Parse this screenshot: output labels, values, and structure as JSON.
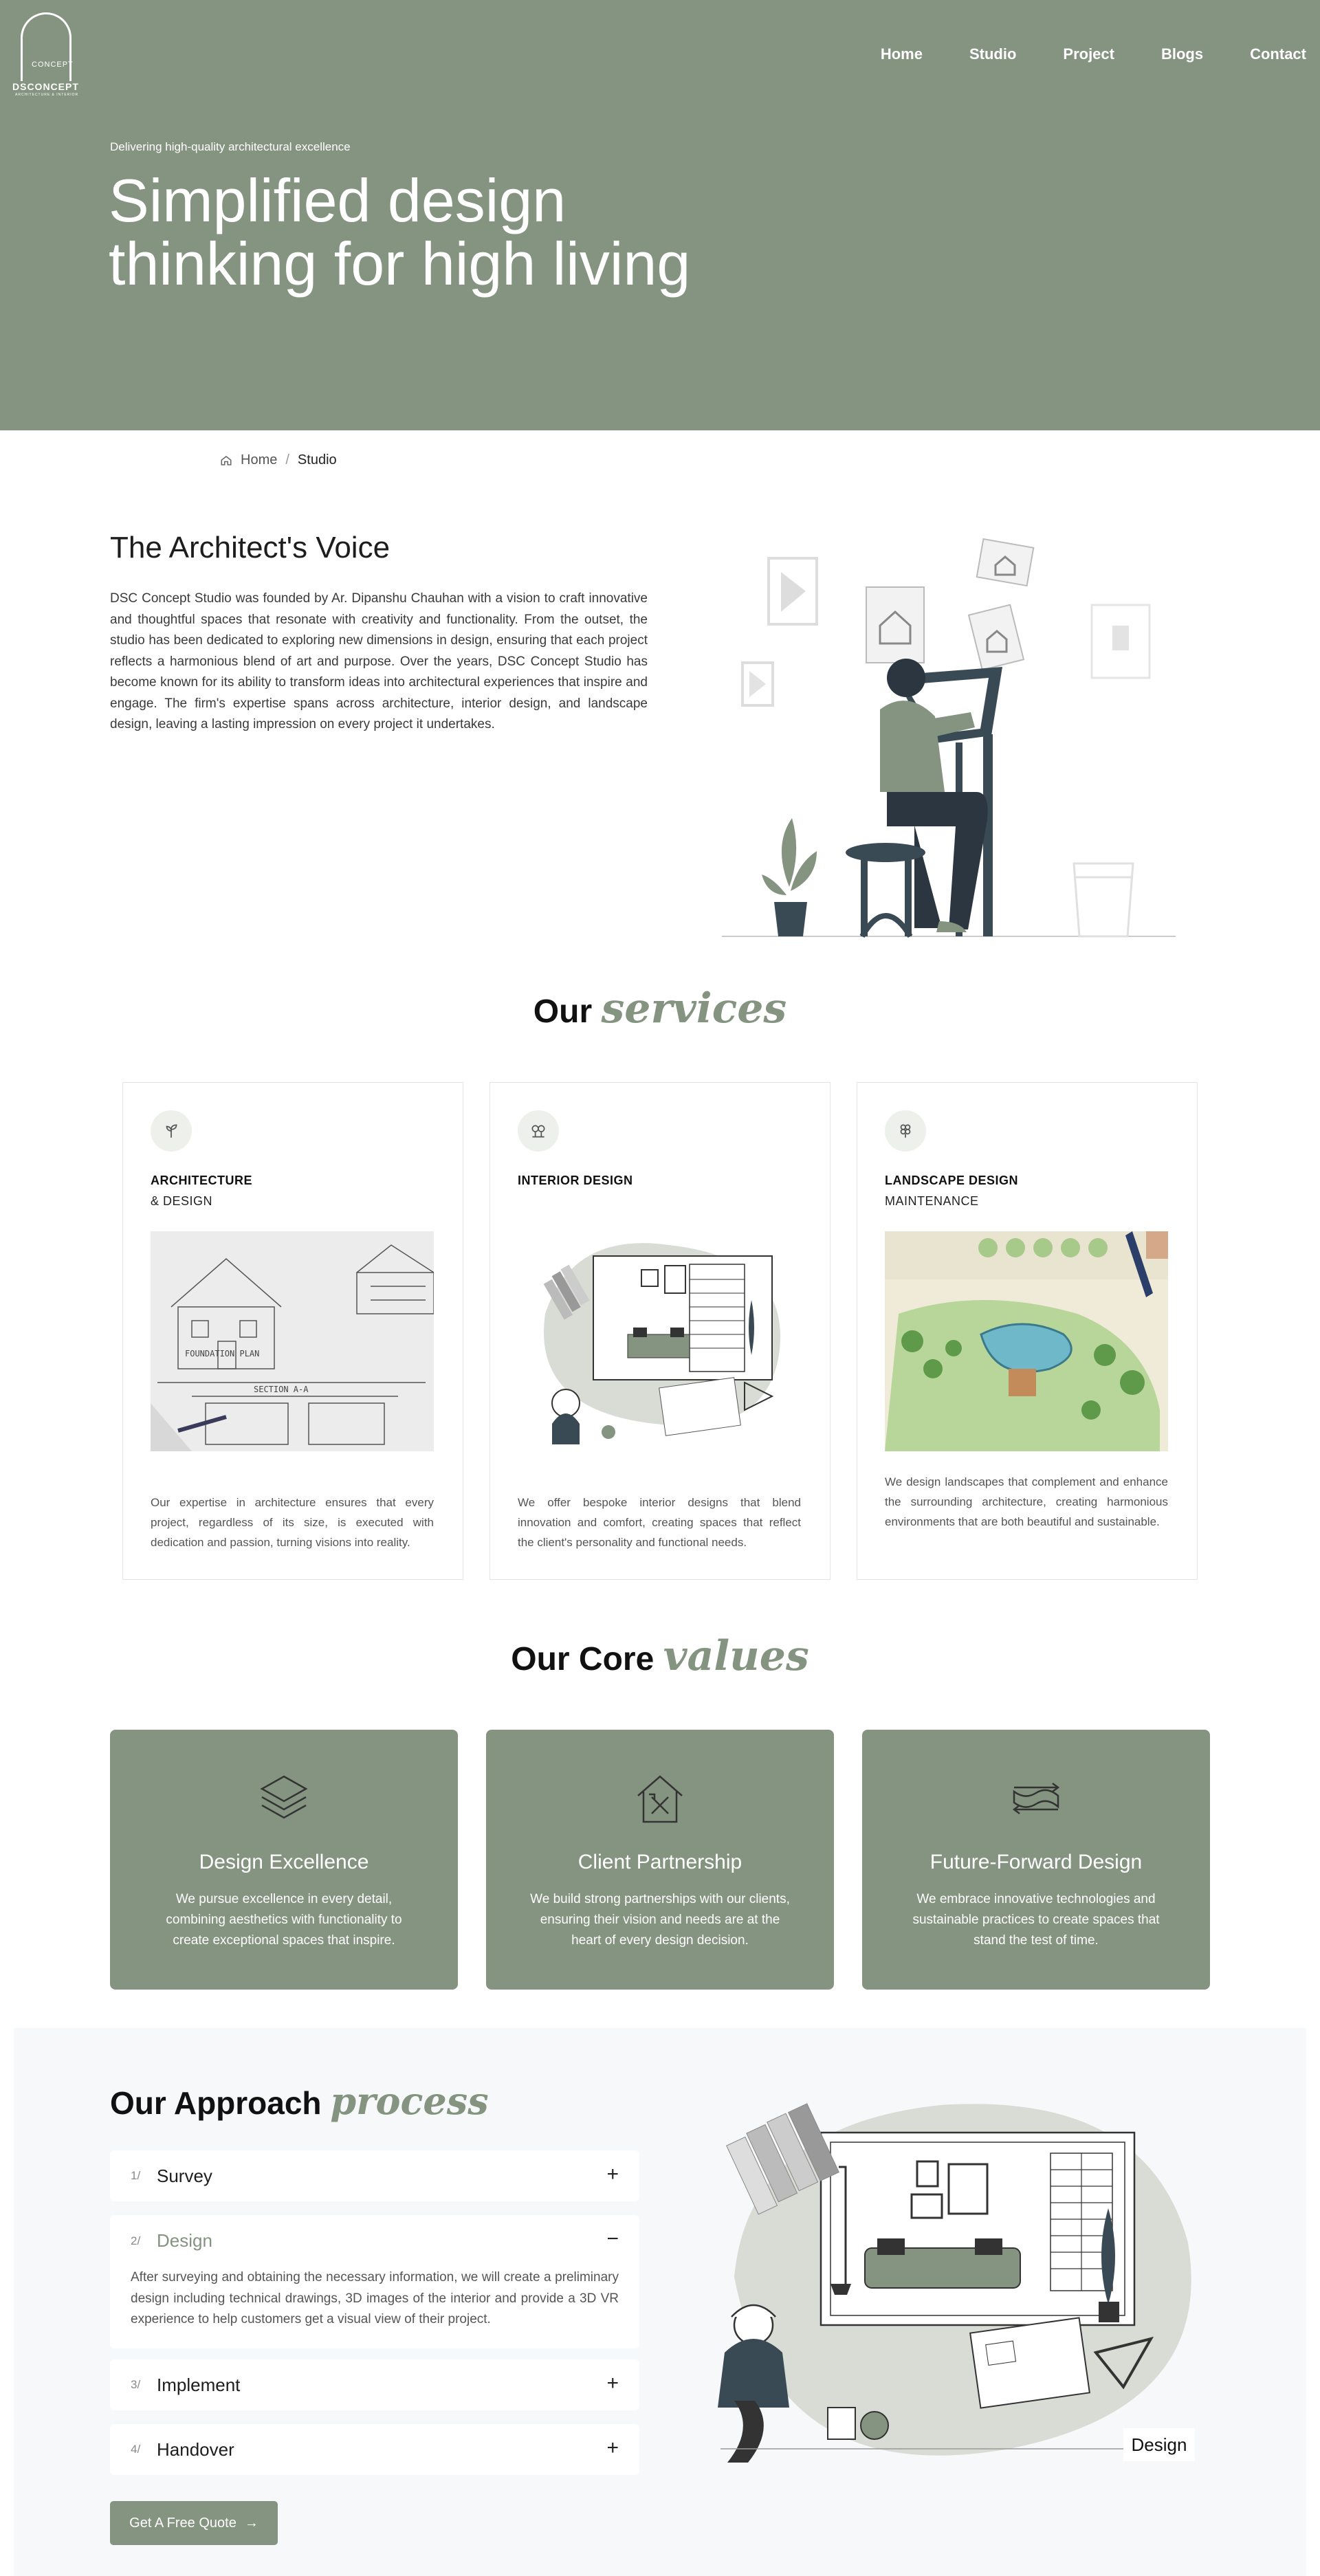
{
  "brand": {
    "name": "DSCONCEPT",
    "concept_word": "CONCEPT",
    "tagline": "ARCHITECTURE & INTERIOR"
  },
  "nav": {
    "items": [
      "Home",
      "Studio",
      "Project",
      "Blogs",
      "Contact"
    ]
  },
  "hero": {
    "kicker": "Delivering high-quality architectural excellence",
    "title_line1": "Simplified design",
    "title_line2": "thinking for high living"
  },
  "breadcrumb": {
    "home": "Home",
    "separator": "/",
    "current": "Studio"
  },
  "about": {
    "title": "The Architect's Voice",
    "text": "DSC Concept Studio was founded by Ar. Dipanshu Chauhan with a vision to craft innovative and thoughtful spaces that resonate with creativity and functionality. From the outset, the studio has been dedicated to exploring new dimensions in design, ensuring that each project reflects a harmonious blend of art and purpose. Over the years, DSC Concept Studio has become known for its ability to transform ideas into architectural experiences that inspire and engage. The firm's expertise spans across architecture, interior design, and landscape design, leaving a lasting impression on every project it undertakes."
  },
  "services": {
    "title_plain": "Our",
    "title_accent": "services",
    "cards": [
      {
        "icon": "sprout-icon",
        "title": "ARCHITECTURE",
        "subtitle": "& DESIGN",
        "description": "Our expertise in architecture ensures that every project, regardless of its size, is executed with dedication and passion, turning visions into reality."
      },
      {
        "icon": "trees-icon",
        "title": "INTERIOR DESIGN",
        "subtitle": "",
        "description": "We offer bespoke interior designs that blend innovation and comfort, creating spaces that reflect the client's personality and functional needs."
      },
      {
        "icon": "leaf-grid-icon",
        "title": "LANDSCAPE DESIGN",
        "subtitle": "MAINTENANCE",
        "description": "We design landscapes that complement and enhance the surrounding architecture, creating harmonious environments that are both beautiful and sustainable."
      }
    ]
  },
  "values": {
    "title_plain": "Our Core",
    "title_accent": "values",
    "cards": [
      {
        "icon": "layers-icon",
        "title": "Design Excellence",
        "description": "We pursue excellence in every detail, combining aesthetics with functionality to create exceptional spaces that inspire."
      },
      {
        "icon": "house-tools-icon",
        "title": "Client Partnership",
        "description": "We build strong partnerships with our clients, ensuring their vision and needs are at the heart of every design decision."
      },
      {
        "icon": "map-arrows-icon",
        "title": "Future-Forward Design",
        "description": "We embrace innovative technologies and sustainable practices to create spaces that stand the test of time."
      }
    ]
  },
  "approach": {
    "title_plain": "Our Approach",
    "title_accent": "process",
    "steps": [
      {
        "num": "1/",
        "label": "Survey",
        "toggle": "+"
      },
      {
        "num": "2/",
        "label": "Design",
        "toggle": "−",
        "body": "After surveying and obtaining the necessary information, we will create a preliminary design including technical drawings, 3D images of the interior and provide a 3D VR experience to help customers get a visual view of their project."
      },
      {
        "num": "3/",
        "label": "Implement",
        "toggle": "+"
      },
      {
        "num": "4/",
        "label": "Handover",
        "toggle": "+"
      }
    ],
    "cta": "Get A Free Quote",
    "cta_arrow": "→",
    "illustration_label": "Design"
  },
  "colors": {
    "accent": "#849480",
    "light_bg": "#f7f8f9",
    "card_border": "#e4e4e4"
  }
}
